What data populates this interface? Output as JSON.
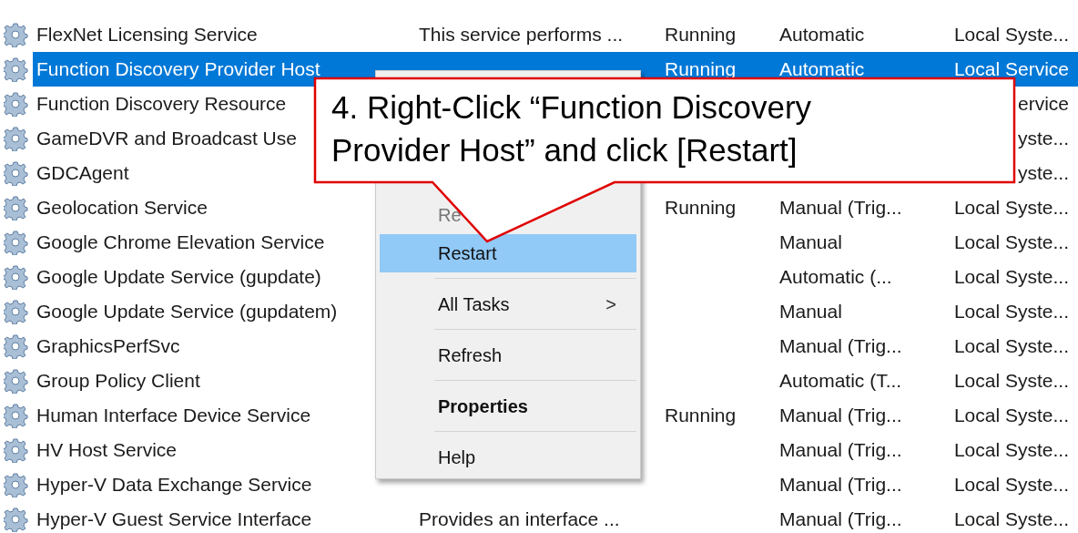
{
  "services": [
    {
      "name": "FlexNet Licensing Service",
      "description": "This service performs ...",
      "status": "Running",
      "startup": "Automatic",
      "logon": "Local Syste...",
      "selected": false
    },
    {
      "name": "Function Discovery Provider Host",
      "status": "Running",
      "startup": "Automatic",
      "logon": "Local Service",
      "selected": true
    },
    {
      "name": "Function Discovery Resource",
      "logon": "ervice",
      "selected": false
    },
    {
      "name": "GameDVR and Broadcast Use",
      "logon": "yste...",
      "selected": false
    },
    {
      "name": "GDCAgent",
      "logon": "yste...",
      "selected": false
    },
    {
      "name": "Geolocation Service",
      "status": "Running",
      "startup": "Manual (Trig...",
      "logon": "Local Syste...",
      "selected": false
    },
    {
      "name": "Google Chrome Elevation Service",
      "startup": "Manual",
      "logon": "Local Syste...",
      "selected": false
    },
    {
      "name": "Google Update Service (gupdate)",
      "startup": "Automatic (...",
      "logon": "Local Syste...",
      "selected": false
    },
    {
      "name": "Google Update Service (gupdatem)",
      "startup": "Manual",
      "logon": "Local Syste...",
      "selected": false
    },
    {
      "name": "GraphicsPerfSvc",
      "startup": "Manual (Trig...",
      "logon": "Local Syste...",
      "selected": false
    },
    {
      "name": "Group Policy Client",
      "startup": "Automatic (T...",
      "logon": "Local Syste...",
      "selected": false
    },
    {
      "name": "Human Interface Device Service",
      "status": "Running",
      "startup": "Manual (Trig...",
      "logon": "Local Syste...",
      "selected": false
    },
    {
      "name": "HV Host Service",
      "startup": "Manual (Trig...",
      "logon": "Local Syste...",
      "selected": false
    },
    {
      "name": "Hyper-V Data Exchange Service",
      "startup": "Manual (Trig...",
      "logon": "Local Syste...",
      "selected": false
    },
    {
      "name": "Hyper-V Guest Service Interface",
      "description": "Provides an interface ...",
      "startup": "Manual (Trig...",
      "logon": "Local Syste...",
      "selected": false
    }
  ],
  "context_menu": {
    "items": [
      {
        "label": "Re",
        "disabled": true,
        "selected": false,
        "bold": false
      },
      {
        "label": "Restart",
        "disabled": false,
        "selected": true,
        "bold": false,
        "separator_after": true
      },
      {
        "label": "All Tasks",
        "disabled": false,
        "selected": false,
        "bold": false,
        "submenu_arrow": ">",
        "separator_after": true
      },
      {
        "label": "Refresh",
        "disabled": false,
        "selected": false,
        "bold": false,
        "separator_after": true
      },
      {
        "label": "Properties",
        "disabled": false,
        "selected": false,
        "bold": true,
        "separator_after": true
      },
      {
        "label": "Help",
        "disabled": false,
        "selected": false,
        "bold": false
      }
    ]
  },
  "callout": {
    "text": "4. Right-Click “Function Discovery Provider Host” and click [Restart]"
  }
}
